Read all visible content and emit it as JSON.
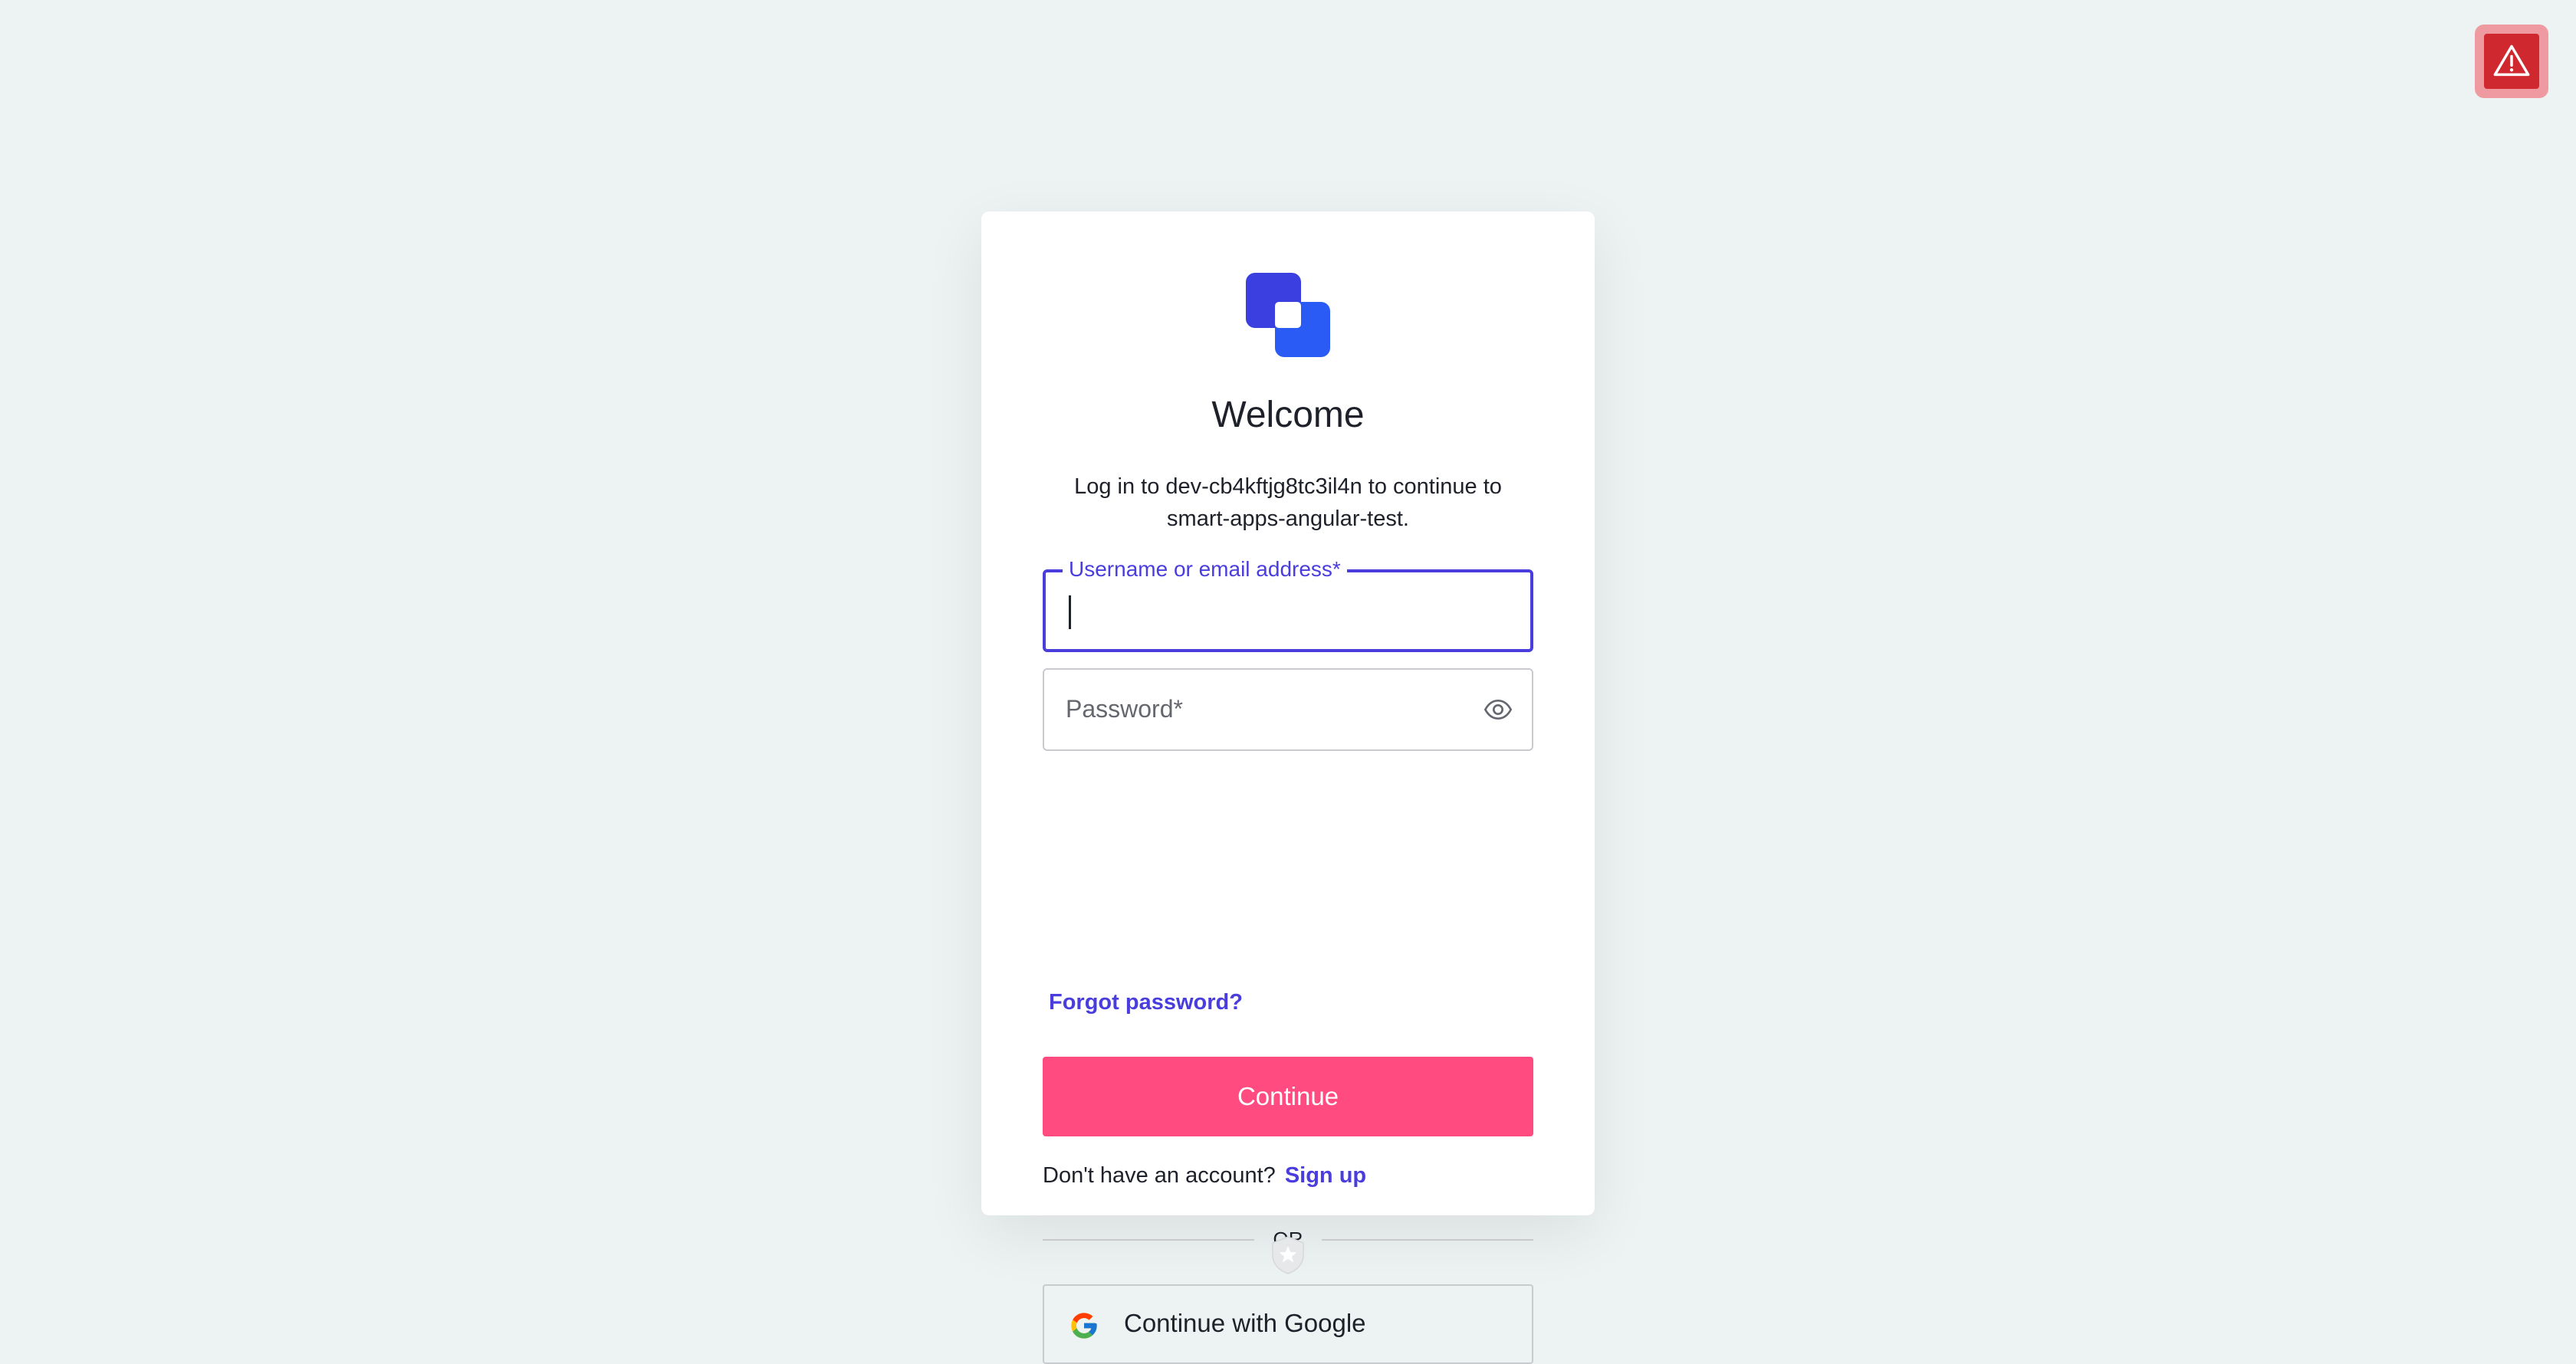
{
  "alert": {
    "icon": "warning-triangle-icon",
    "colors": {
      "outer": "#ee9aa0",
      "inner": "#d0282f"
    }
  },
  "brand": {
    "logo_icon": "overlapping-squares-logo",
    "colors": {
      "primary": "#3b3fe0",
      "secondary": "#2a5cf5"
    }
  },
  "login": {
    "title": "Welcome",
    "subtitle": "Log in to dev-cb4kftjg8tc3il4n to continue to smart-apps-angular-test.",
    "username": {
      "label": "Username or email address*",
      "value": ""
    },
    "password": {
      "placeholder": "Password*",
      "value": "",
      "toggle_icon": "eye-icon"
    },
    "forgot_password": "Forgot password?",
    "continue_label": "Continue",
    "signup_prompt": "Don't have an account?",
    "signup_link": "Sign up",
    "divider": "OR",
    "google_label": "Continue with Google",
    "google_icon": "google-g-icon"
  },
  "footer": {
    "badge_icon": "auth0-shield-star-icon"
  },
  "theme": {
    "accent": "#4a3dde",
    "button": "#ff4b80",
    "background": "#edf2f2",
    "text": "#1e212a"
  }
}
